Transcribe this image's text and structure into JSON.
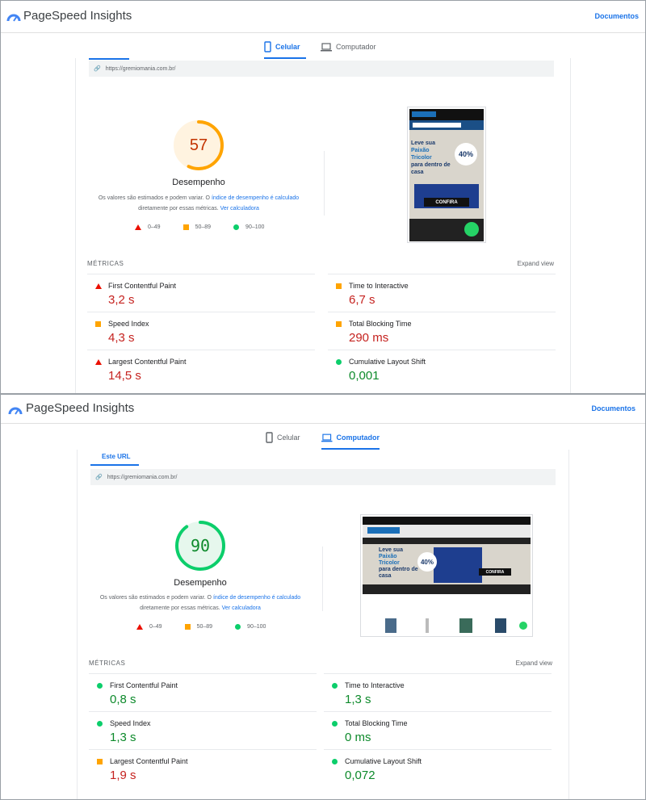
{
  "header": {
    "title": "PageSpeed Insights",
    "docs": "Documentos"
  },
  "tabs": {
    "mobile": "Celular",
    "desktop": "Computador"
  },
  "url": "https://gremiomania.com.br/",
  "url_tab": "Este URL",
  "perf_label": "Desempenho",
  "disclaimer": {
    "p1": "Os valores são estimados e podem variar. O",
    "link1": "índice de desempenho é calculado",
    "p2": "diretamente por essas métricas.",
    "link2": "Ver calculadora"
  },
  "legend": {
    "red": "0–49",
    "orange": "50–89",
    "green": "90–100"
  },
  "metrics_title": "MÉTRICAS",
  "expand": "Expand view",
  "colors": {
    "accent": "#1a73e8",
    "fail": "#eb0f00",
    "average": "#ffa400",
    "pass": "#0cce6b"
  },
  "mobile": {
    "score": "57",
    "score_value": 57,
    "metrics": [
      {
        "name": "First Contentful Paint",
        "value": "3,2 s",
        "status": "fail"
      },
      {
        "name": "Time to Interactive",
        "value": "6,7 s",
        "status": "average"
      },
      {
        "name": "Speed Index",
        "value": "4,3 s",
        "status": "average"
      },
      {
        "name": "Total Blocking Time",
        "value": "290 ms",
        "status": "average"
      },
      {
        "name": "Largest Contentful Paint",
        "value": "14,5 s",
        "status": "fail"
      },
      {
        "name": "Cumulative Layout Shift",
        "value": "0,001",
        "status": "pass"
      }
    ]
  },
  "desktop": {
    "score": "90",
    "score_value": 90,
    "metrics": [
      {
        "name": "First Contentful Paint",
        "value": "0,8 s",
        "status": "pass"
      },
      {
        "name": "Time to Interactive",
        "value": "1,3 s",
        "status": "pass"
      },
      {
        "name": "Speed Index",
        "value": "1,3 s",
        "status": "pass"
      },
      {
        "name": "Total Blocking Time",
        "value": "0 ms",
        "status": "pass"
      },
      {
        "name": "Largest Contentful Paint",
        "value": "1,9 s",
        "status": "average"
      },
      {
        "name": "Cumulative Layout Shift",
        "value": "0,072",
        "status": "pass"
      }
    ]
  },
  "preview": {
    "headline": "Leve sua",
    "headline2": "Paixão Tricolor",
    "headline3": "para dentro de casa",
    "discount": "40%",
    "cta": "CONFIRA"
  }
}
